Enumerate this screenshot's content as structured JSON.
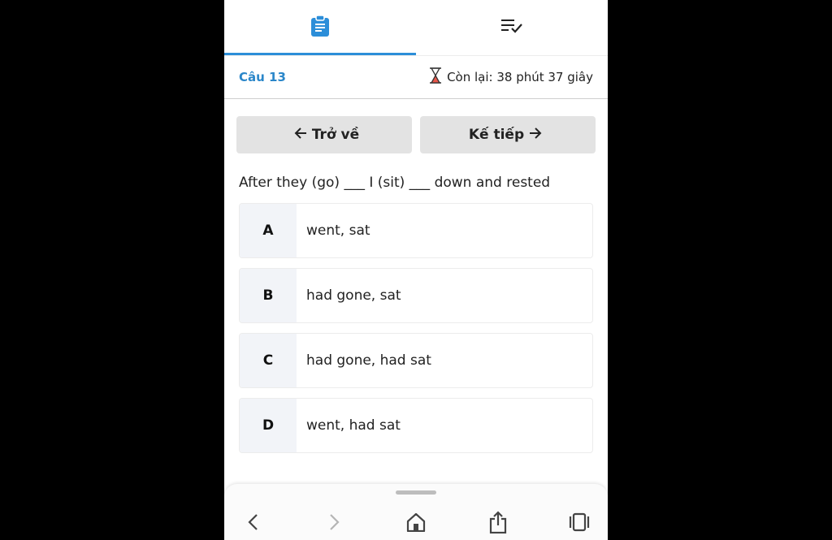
{
  "colors": {
    "accent": "#2c8ed9",
    "question_no": "#2a86c9",
    "button_bg": "#e3e3e3",
    "letter_bg": "#f2f4f8"
  },
  "tabs": [
    {
      "icon": "clipboard-icon",
      "active": true
    },
    {
      "icon": "checklist-icon",
      "active": false
    }
  ],
  "infobar": {
    "question_no": "Câu 13",
    "timer": "Còn lại: 38 phút 37 giây"
  },
  "nav": {
    "back_label": "Trở về",
    "next_label": "Kế tiếp"
  },
  "question": "After they (go) ___ I (sit) ___ down and rested",
  "options": [
    {
      "letter": "A",
      "text": "went, sat"
    },
    {
      "letter": "B",
      "text": "had gone, sat"
    },
    {
      "letter": "C",
      "text": "had gone, had sat"
    },
    {
      "letter": "D",
      "text": "went, had sat"
    }
  ],
  "browser_bar": {
    "icons": [
      "back-icon",
      "forward-icon",
      "home-icon",
      "share-icon",
      "tabs-icon"
    ]
  }
}
